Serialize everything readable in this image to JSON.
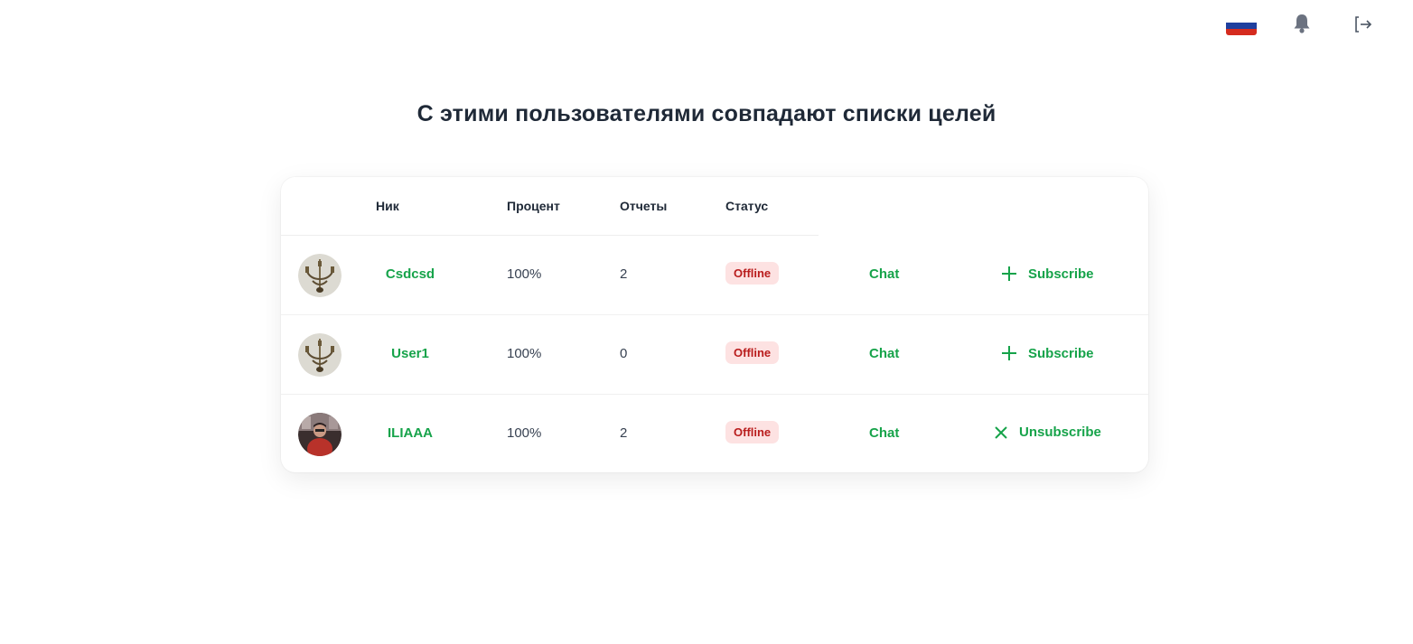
{
  "header": {
    "flag_icon": "russia-flag-icon",
    "bell_icon": "bell-icon",
    "logout_icon": "logout-icon"
  },
  "page": {
    "title": "С этими пользователями совпадают списки целей"
  },
  "table": {
    "columns": {
      "nick": "Ник",
      "percent": "Процент",
      "reports": "Отчеты",
      "status": "Статус"
    },
    "rows": [
      {
        "nick": "Csdcsd",
        "percent": "100%",
        "reports": "2",
        "status": "Offline",
        "chat": "Chat",
        "action": "Subscribe",
        "action_icon": "plus-icon"
      },
      {
        "nick": "User1",
        "percent": "100%",
        "reports": "0",
        "status": "Offline",
        "chat": "Chat",
        "action": "Subscribe",
        "action_icon": "plus-icon"
      },
      {
        "nick": "ILIAAA",
        "percent": "100%",
        "reports": "2",
        "status": "Offline",
        "chat": "Chat",
        "action": "Unsubscribe",
        "action_icon": "close-icon"
      }
    ]
  },
  "colors": {
    "accent_green": "#16a34a",
    "offline_bg": "#fde2e2",
    "offline_text": "#b91c1c"
  }
}
